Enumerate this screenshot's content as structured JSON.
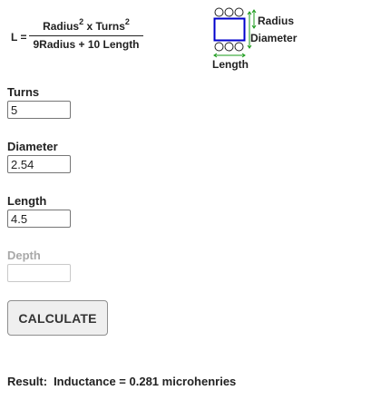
{
  "formula": {
    "lhs": "L =",
    "numerator": {
      "part1": "Radius",
      "exp1": "2",
      "part2": " x Turns",
      "exp2": "2"
    },
    "denominator": "9Radius + 10 Length"
  },
  "diagram": {
    "radius_label": "Radius",
    "diameter_label": "Diameter",
    "length_label": "Length",
    "colors": {
      "coil_box": "#0000cc",
      "arrows": "#1a9b1a",
      "turns": "#222222"
    }
  },
  "fields": {
    "turns": {
      "label": "Turns",
      "value": "5"
    },
    "diameter": {
      "label": "Diameter",
      "value": "2.54"
    },
    "length": {
      "label": "Length",
      "value": "4.5"
    },
    "depth": {
      "label": "Depth",
      "value": "",
      "disabled": true
    }
  },
  "button": {
    "label": "CALCULATE"
  },
  "result": {
    "prefix": "Result:",
    "text": "Inductance = 0.281 microhenries"
  }
}
